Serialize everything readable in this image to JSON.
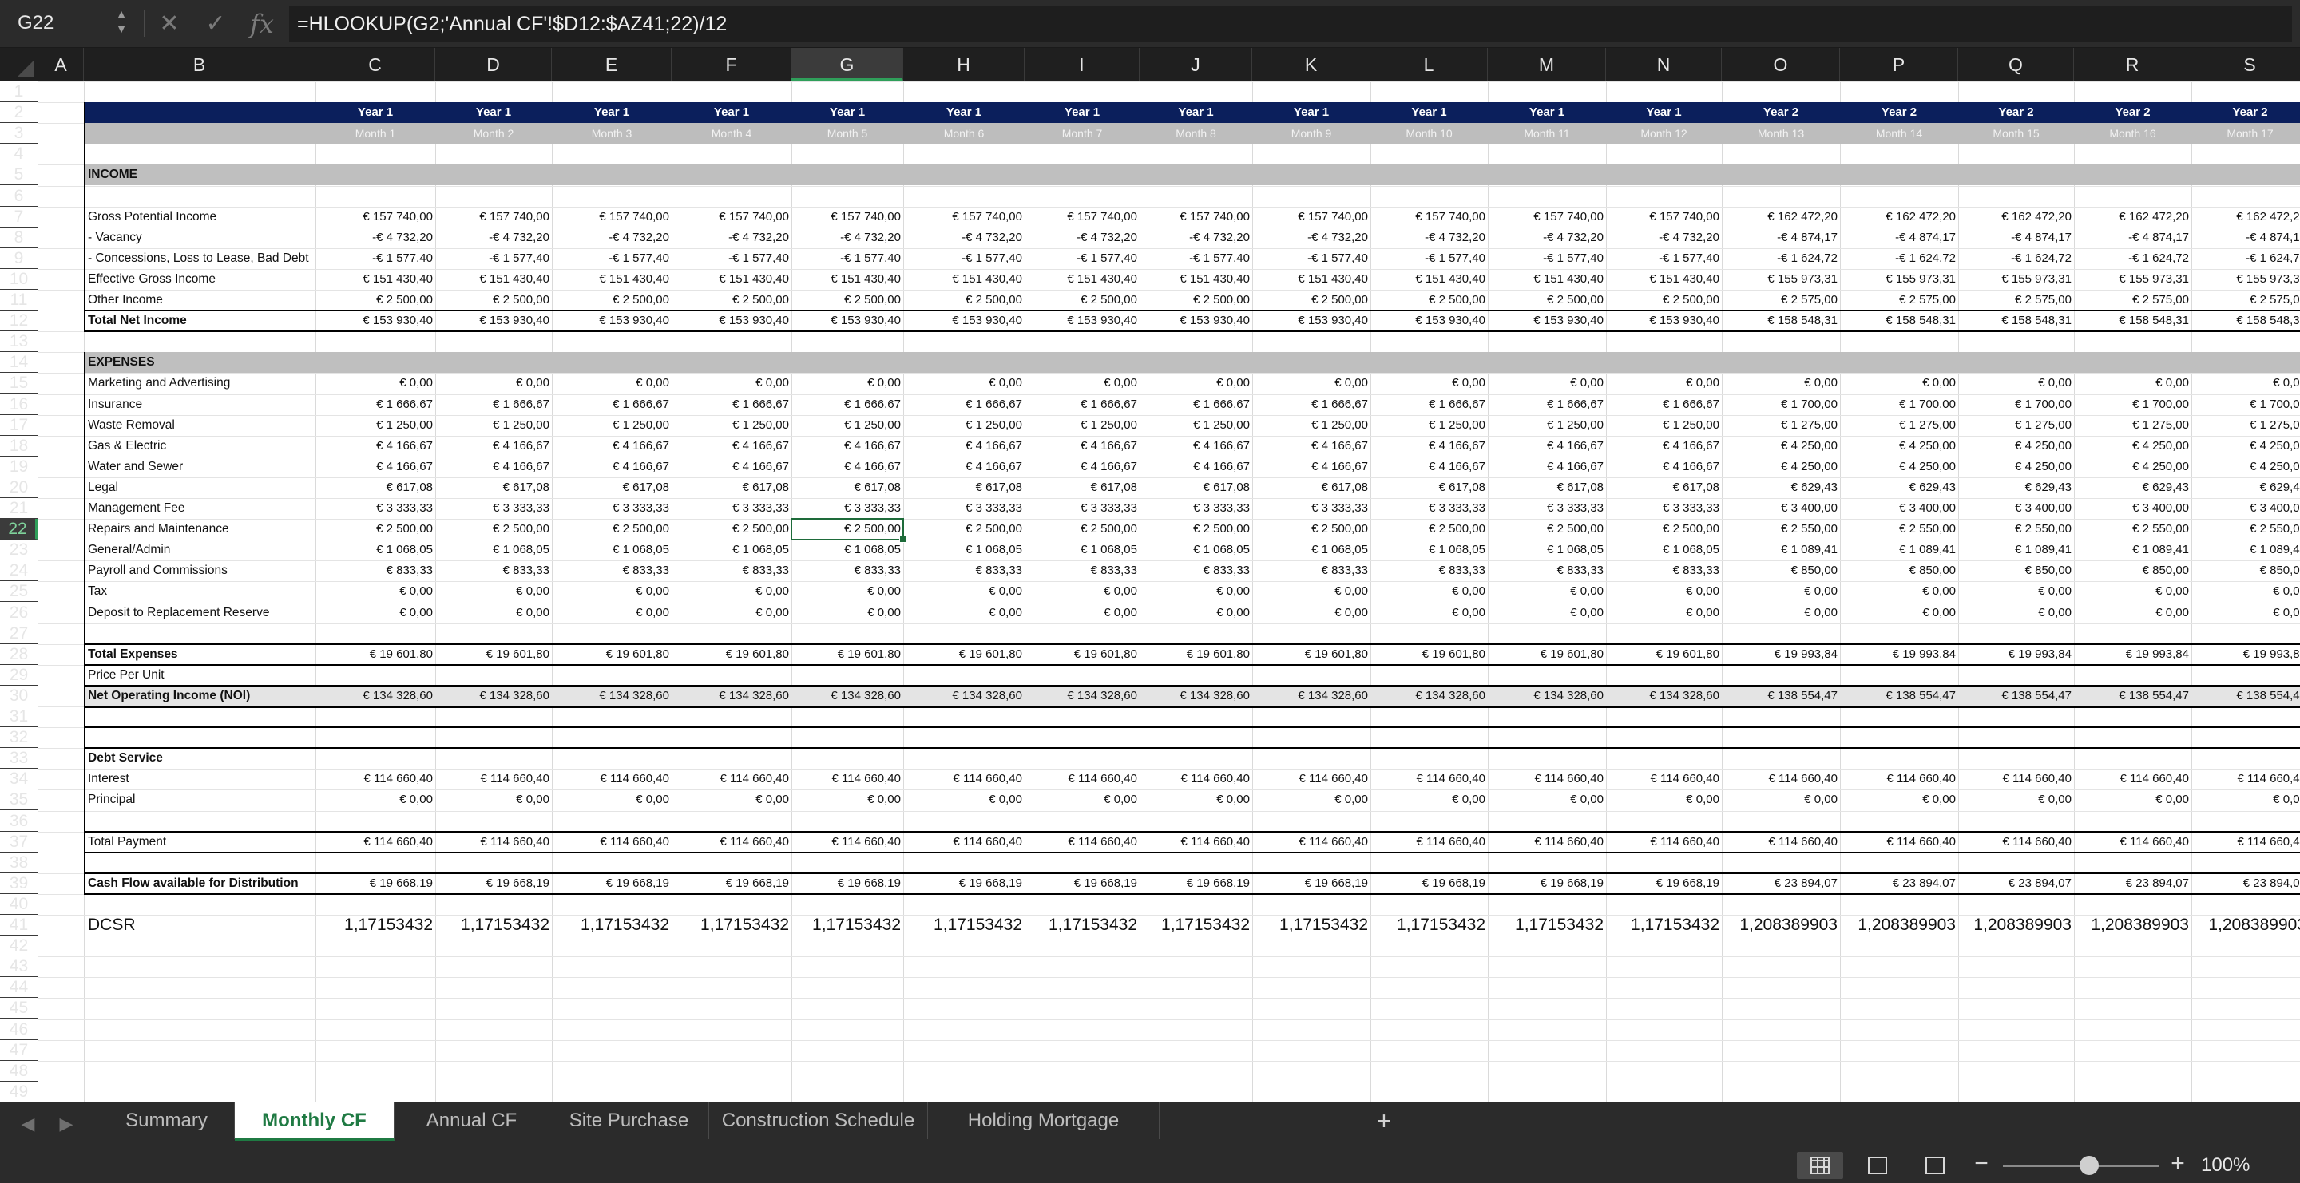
{
  "formula_bar": {
    "cell_reference": "G22",
    "formula": "=HLOOKUP(G2;'Annual CF'!$D12:$AZ41;22)/12",
    "icons": [
      "cancel-icon",
      "confirm-icon",
      "fx-icon"
    ],
    "fx_label": "fx"
  },
  "columns": [
    "A",
    "B",
    "C",
    "D",
    "E",
    "F",
    "G",
    "H",
    "I",
    "J",
    "K",
    "L",
    "M",
    "N",
    "O",
    "P",
    "Q",
    "R",
    "S"
  ],
  "selected_column": "G",
  "selected_row": 22,
  "rows": [
    "1",
    "2",
    "3",
    "4",
    "5",
    "6",
    "7",
    "8",
    "9",
    "10",
    "11",
    "12",
    "13",
    "14",
    "15",
    "16",
    "17",
    "18",
    "19",
    "20",
    "21",
    "22",
    "23",
    "24",
    "25",
    "26",
    "27",
    "28",
    "29",
    "30",
    "31",
    "32",
    "33",
    "34",
    "35",
    "36",
    "37",
    "38",
    "39",
    "40",
    "41",
    "42",
    "43",
    "44",
    "45",
    "46",
    "47",
    "48",
    "49"
  ],
  "header": {
    "years": [
      "Year 1",
      "Year 1",
      "Year 1",
      "Year 1",
      "Year 1",
      "Year 1",
      "Year 1",
      "Year 1",
      "Year 1",
      "Year 1",
      "Year 1",
      "Year 1",
      "Year 2",
      "Year 2",
      "Year 2",
      "Year 2",
      "Year 2"
    ],
    "months": [
      "Month 1",
      "Month 2",
      "Month 3",
      "Month 4",
      "Month 5",
      "Month 6",
      "Month 7",
      "Month 8",
      "Month 9",
      "Month 10",
      "Month 11",
      "Month 12",
      "Month 13",
      "Month 14",
      "Month 15",
      "Month 16",
      "Month 17"
    ]
  },
  "sections": {
    "income": "INCOME",
    "expenses": "EXPENSES"
  },
  "rows_data": [
    {
      "row": 7,
      "label": "Gross Potential Income",
      "bold": false,
      "y1": "€ 157 740,00",
      "y2": "€ 162 472,20"
    },
    {
      "row": 8,
      "label": " - Vacancy",
      "bold": false,
      "y1": "-€ 4 732,20",
      "y2": "-€ 4 874,17"
    },
    {
      "row": 9,
      "label": " - Concessions, Loss to Lease, Bad Debt",
      "bold": false,
      "y1": "-€ 1 577,40",
      "y2": "-€ 1 624,72"
    },
    {
      "row": 10,
      "label": "Effective Gross Income",
      "bold": false,
      "y1": "€ 151 430,40",
      "y2": "€ 155 973,31"
    },
    {
      "row": 11,
      "label": "Other Income",
      "bold": false,
      "y1": "€ 2 500,00",
      "y2": "€ 2 575,00"
    },
    {
      "row": 12,
      "label": "Total Net Income",
      "bold": true,
      "y1": "€ 153 930,40",
      "y2": "€ 158 548,31"
    },
    {
      "row": 15,
      "label": "Marketing and Advertising",
      "bold": false,
      "y1": "€ 0,00",
      "y2": "€ 0,00"
    },
    {
      "row": 16,
      "label": "Insurance",
      "bold": false,
      "y1": "€ 1 666,67",
      "y2": "€ 1 700,00"
    },
    {
      "row": 17,
      "label": "Waste Removal",
      "bold": false,
      "y1": "€ 1 250,00",
      "y2": "€ 1 275,00"
    },
    {
      "row": 18,
      "label": "Gas & Electric",
      "bold": false,
      "y1": "€ 4 166,67",
      "y2": "€ 4 250,00"
    },
    {
      "row": 19,
      "label": "Water and Sewer",
      "bold": false,
      "y1": "€ 4 166,67",
      "y2": "€ 4 250,00"
    },
    {
      "row": 20,
      "label": "Legal",
      "bold": false,
      "y1": "€ 617,08",
      "y2": "€ 629,43"
    },
    {
      "row": 21,
      "label": "Management Fee",
      "bold": false,
      "y1": "€ 3 333,33",
      "y2": "€ 3 400,00"
    },
    {
      "row": 22,
      "label": "Repairs and Maintenance",
      "bold": false,
      "y1": "€ 2 500,00",
      "y2": "€ 2 550,00"
    },
    {
      "row": 23,
      "label": "General/Admin",
      "bold": false,
      "y1": "€ 1 068,05",
      "y2": "€ 1 089,41"
    },
    {
      "row": 24,
      "label": "Payroll and Commissions",
      "bold": false,
      "y1": "€ 833,33",
      "y2": "€ 850,00"
    },
    {
      "row": 25,
      "label": "Tax",
      "bold": false,
      "y1": "€ 0,00",
      "y2": "€ 0,00"
    },
    {
      "row": 26,
      "label": "Deposit to Replacement Reserve",
      "bold": false,
      "y1": "€ 0,00",
      "y2": "€ 0,00"
    },
    {
      "row": 28,
      "label": "Total Expenses",
      "bold": true,
      "y1": "€ 19 601,80",
      "y2": "€ 19 993,84"
    },
    {
      "row": 29,
      "label": "Price Per Unit",
      "bold": false,
      "y1": "",
      "y2": ""
    },
    {
      "row": 30,
      "label": "Net Operating Income (NOI)",
      "bold": true,
      "y1": "€ 134 328,60",
      "y2": "€ 138 554,47"
    },
    {
      "row": 33,
      "label": "Debt Service",
      "bold": true,
      "y1": "",
      "y2": ""
    },
    {
      "row": 34,
      "label": "Interest",
      "bold": false,
      "y1": "€ 114 660,40",
      "y2": "€ 114 660,40"
    },
    {
      "row": 35,
      "label": "Principal",
      "bold": false,
      "y1": "€ 0,00",
      "y2": "€ 0,00"
    },
    {
      "row": 37,
      "label": "Total Payment",
      "bold": false,
      "y1": "€ 114 660,40",
      "y2": "€ 114 660,40"
    },
    {
      "row": 39,
      "label": "Cash Flow available for Distribution",
      "bold": true,
      "y1": "€ 19 668,19",
      "y2": "€ 23 894,07"
    },
    {
      "row": 41,
      "label": "DCSR",
      "bold": false,
      "y1": "1,17153432",
      "y2": "1,208389903",
      "big": true
    }
  ],
  "sheet_tabs": [
    {
      "label": "Summary",
      "active": false
    },
    {
      "label": "Monthly CF",
      "active": true
    },
    {
      "label": "Annual CF",
      "active": false
    },
    {
      "label": "Site Purchase",
      "active": false
    },
    {
      "label": "Construction Schedule Calc",
      "active": false
    },
    {
      "label": "Holding Mortgage Schedule",
      "active": false
    }
  ],
  "tab_nav": {
    "prev": "◀",
    "next": "▶",
    "add": "+"
  },
  "status_bar": {
    "zoom_level": "100%",
    "zoom_fraction": 0.55,
    "zoom_minus": "−",
    "zoom_plus": "+"
  },
  "colors": {
    "header_band": "#0b1f5c",
    "month_band": "#bdbdbd",
    "section_band": "#bfbfbf",
    "selection": "#1e6b3a",
    "active_tab_text": "#1f7a43"
  }
}
